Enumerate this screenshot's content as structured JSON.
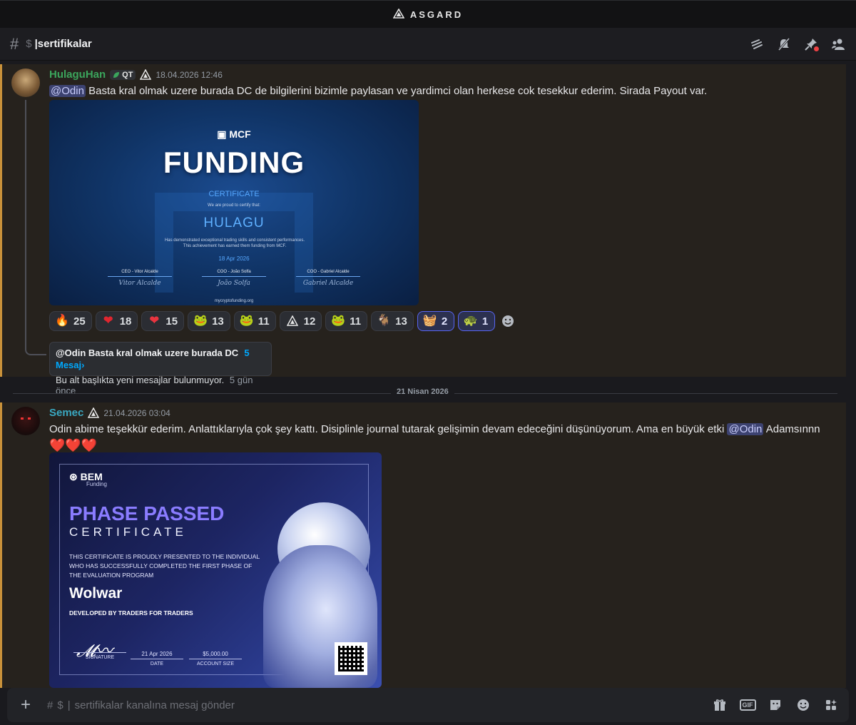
{
  "window": {
    "title": "ASGARD"
  },
  "channel": {
    "hash": "#",
    "dollar": "$",
    "name": "|sertifikalar"
  },
  "messages": [
    {
      "username": "HulaguHan",
      "username_color": "#3ba55c",
      "tag": "QT",
      "timestamp": "18.04.2026 12:46",
      "mention": "@Odin",
      "text": "Basta kral olmak uzere burada DC de bilgilerini bizimle paylasan ve yardimci olan herkese cok tesekkur ederim. Sirada Payout var.",
      "certificate": {
        "brand": "MCF",
        "heading": "FUNDING",
        "title": "CERTIFICATE",
        "proud": "We are proud to certify that:",
        "recipient": "HULAGU",
        "description": "Has demonstrated exceptional trading skills and consistent performances. This achievement has earned them funding from MCF.",
        "date": "18 Apr 2026",
        "signers": [
          "CEO - Vitor Alcalde",
          "COO - João Solfa",
          "COO - Gabriel Alcalde"
        ],
        "signatures": [
          "Vitor Alcalde",
          "João Solfa",
          "Gabriel Alcalde"
        ],
        "site": "mycryptofunding.org"
      },
      "reactions": [
        {
          "emoji": "fire",
          "glyph": "🔥",
          "count": "25",
          "active": false
        },
        {
          "emoji": "pixel-heart",
          "glyph": "❤",
          "count": "18",
          "active": false
        },
        {
          "emoji": "heart",
          "glyph": "❤",
          "count": "15",
          "active": false
        },
        {
          "emoji": "pepe-hat",
          "glyph": "🐸",
          "count": "13",
          "active": false
        },
        {
          "emoji": "pepe",
          "glyph": "🐸",
          "count": "11",
          "active": false
        },
        {
          "emoji": "asgard-logo",
          "glyph": "▲",
          "count": "12",
          "active": false
        },
        {
          "emoji": "pepe-sleep",
          "glyph": "🐸",
          "count": "11",
          "active": false
        },
        {
          "emoji": "goat",
          "glyph": "🐐",
          "count": "13",
          "active": false
        },
        {
          "emoji": "blue-basket",
          "glyph": "🧺",
          "count": "2",
          "active": true
        },
        {
          "emoji": "green-tank",
          "glyph": "🐢",
          "count": "1",
          "active": true
        }
      ],
      "thread": {
        "title": "@Odin Basta kral olmak uzere burada DC",
        "count": "5 Mesaj›",
        "empty": "Bu alt başlıkta yeni mesajlar bulunmuyor.",
        "time": "5 gün önce"
      }
    },
    {
      "username": "Semec",
      "username_color": "#3aa8c1",
      "timestamp": "21.04.2026 03:04",
      "text": "Odin abime teşekkür ederim. Anlattıklarıyla çok şey kattı. Disiplinle journal tutarak gelişimin devam edeceğini düşünüyorum. Ama en büyük etki",
      "mention": "@Odin",
      "text_after": "Adamsınnn",
      "hearts": "❤️❤️❤️",
      "certificate": {
        "brand": "BEM",
        "brand_sub": "Funding",
        "heading": "PHASE PASSED",
        "title": "CERTIFICATE",
        "body": "THIS CERTIFICATE IS PROUDLY PRESENTED TO THE INDIVIDUAL WHO HAS SUCCESSFULLY COMPLETED THE FIRST PHASE OF THE EVALUATION PROGRAM",
        "recipient": "Wolwar",
        "tagline": "DEVELOPED BY TRADERS FOR TRADERS",
        "signature_label": "SIGNATURE",
        "date_value": "21 Apr 2026",
        "date_label": "DATE",
        "account_value": "$5,000.00",
        "account_label": "ACCOUNT SIZE"
      }
    }
  ],
  "date_divider": "21 Nisan 2026",
  "composer": {
    "hash": "#",
    "dollar": "$",
    "placeholder": "sertifikalar kanalına mesaj gönder"
  },
  "colors": {
    "accent_border": "#c8913a",
    "mention_bg": "#3c4270",
    "link": "#00a8fc"
  }
}
